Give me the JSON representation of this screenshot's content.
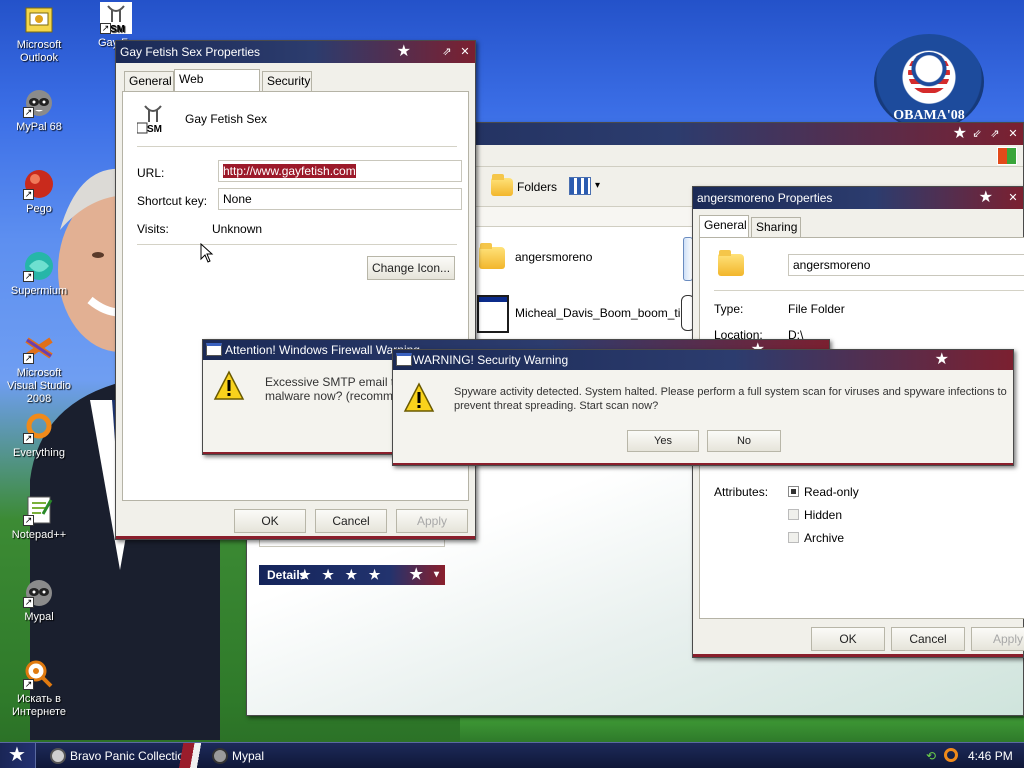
{
  "desktop": {
    "icons": [
      {
        "label": "Microsoft Outlook",
        "icon": "outlook-icon"
      },
      {
        "label": "Gay Fe",
        "icon": "dsm-shortcut-icon"
      },
      {
        "label": "MyPal 68",
        "icon": "raccoon-icon"
      },
      {
        "label": "Pego",
        "icon": "pego-icon"
      },
      {
        "label": "Supermium",
        "icon": "supermium-icon"
      },
      {
        "label": "Microsoft Visual Studio 2008",
        "icon": "visual-studio-icon"
      },
      {
        "label": "Everything",
        "icon": "everything-icon"
      },
      {
        "label": "Notepad++",
        "icon": "notepad-plus-plus-icon"
      },
      {
        "label": "Mypal",
        "icon": "raccoon-icon"
      },
      {
        "label": "Искать в Интернете",
        "icon": "search-internet-icon"
      }
    ],
    "wallpaper_logo_text": "OBAMA'08"
  },
  "gay_props": {
    "title": "Gay Fetish Sex Properties",
    "tabs": [
      "General",
      "Web Document",
      "Security"
    ],
    "active_tab": "Web Document",
    "shortcut_name": "Gay Fetish Sex",
    "url_label": "URL:",
    "url_value": "http://www.gayfetish.com",
    "shortcut_label": "Shortcut key:",
    "shortcut_value": "None",
    "visits_label": "Visits:",
    "visits_value": "Unknown",
    "change_icon_label": "Change Icon...",
    "ok_label": "OK",
    "cancel_label": "Cancel",
    "apply_label": "Apply"
  },
  "explorer": {
    "folders_label": "Folders",
    "items": [
      "angersmoreno",
      "Micheal_Davis_Boom_boom_time"
    ],
    "details_label": "Details"
  },
  "anger_props": {
    "title": "angersmoreno Properties",
    "tabs": [
      "General",
      "Sharing"
    ],
    "active_tab": "General",
    "name_value": "angersmoreno",
    "type_label": "Type:",
    "type_value": "File Folder",
    "location_label": "Location:",
    "location_value": "D:\\",
    "attributes_label": "Attributes:",
    "attrs": [
      {
        "label": "Read-only",
        "checked": true
      },
      {
        "label": "Hidden",
        "checked": false
      },
      {
        "label": "Archive",
        "checked": false
      }
    ],
    "ok_label": "OK",
    "cancel_label": "Cancel",
    "apply_label": "Apply"
  },
  "firewall": {
    "title": "Attention! Windows Firewall Warning",
    "message_line1": "Excessive SMTP email traff",
    "message_line2": "malware now? (recommenc"
  },
  "security": {
    "title": "WARNING! Security Warning",
    "message_line1": "Spyware activity detected. System halted. Please perform a full system scan for viruses and spyware infections to",
    "message_line2": "prevent threat spreading. Start scan now?",
    "yes_label": "Yes",
    "no_label": "No"
  },
  "taskbar": {
    "items": [
      "Bravo Panic Collection",
      "Mypal"
    ],
    "clock": "4:46 PM"
  }
}
